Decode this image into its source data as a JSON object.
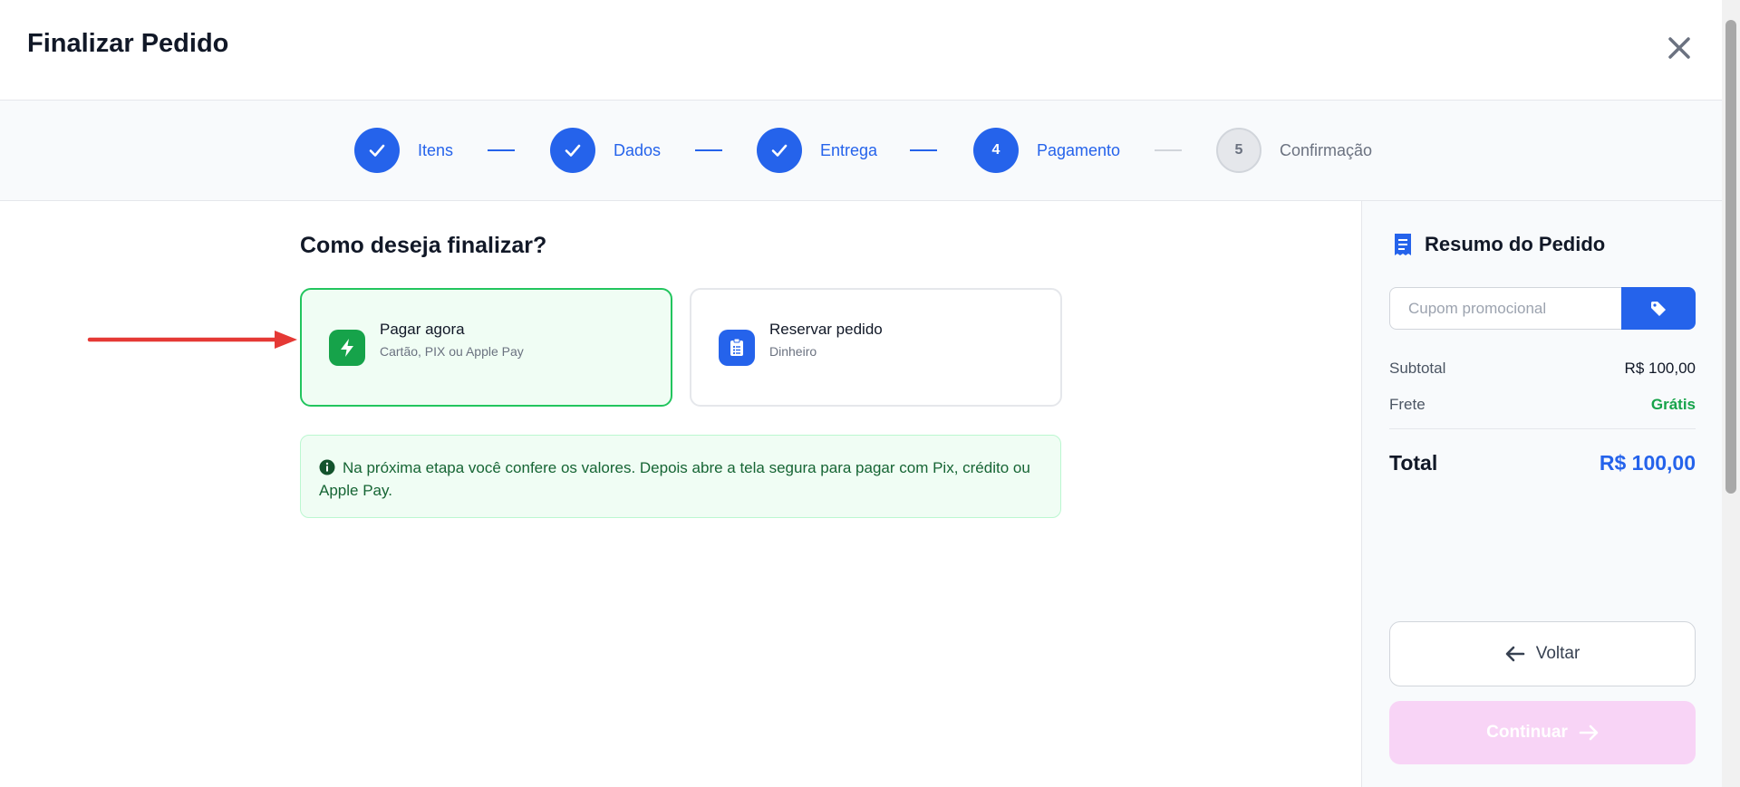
{
  "header": {
    "title": "Finalizar Pedido"
  },
  "steps": [
    {
      "label": "Itens",
      "number": "",
      "state": "done"
    },
    {
      "label": "Dados",
      "number": "",
      "state": "done"
    },
    {
      "label": "Entrega",
      "number": "",
      "state": "done"
    },
    {
      "label": "Pagamento",
      "number": "4",
      "state": "active"
    },
    {
      "label": "Confirmação",
      "number": "5",
      "state": "pending"
    }
  ],
  "main": {
    "question": "Como deseja finalizar?",
    "options": [
      {
        "title": "Pagar agora",
        "subtitle": "Cartão, PIX ou Apple Pay",
        "selected": true,
        "icon": "lightning-icon"
      },
      {
        "title": "Reservar pedido",
        "subtitle": "Dinheiro",
        "selected": false,
        "icon": "clipboard-icon"
      }
    ],
    "info": "Na próxima etapa você confere os valores. Depois abre a tela segura para pagar com Pix, crédito ou Apple Pay."
  },
  "summary": {
    "title": "Resumo do Pedido",
    "coupon_placeholder": "Cupom promocional",
    "subtotal_label": "Subtotal",
    "subtotal_value": "R$ 100,00",
    "shipping_label": "Frete",
    "shipping_value": "Grátis",
    "total_label": "Total",
    "total_value": "R$ 100,00",
    "back_label": "Voltar",
    "continue_label": "Continuar"
  },
  "colors": {
    "primary": "#2563eb",
    "success": "#16a34a",
    "selected_bg": "#f0fdf4",
    "continue_disabled": "#f8d4f6",
    "annotation_arrow": "#e53935"
  }
}
